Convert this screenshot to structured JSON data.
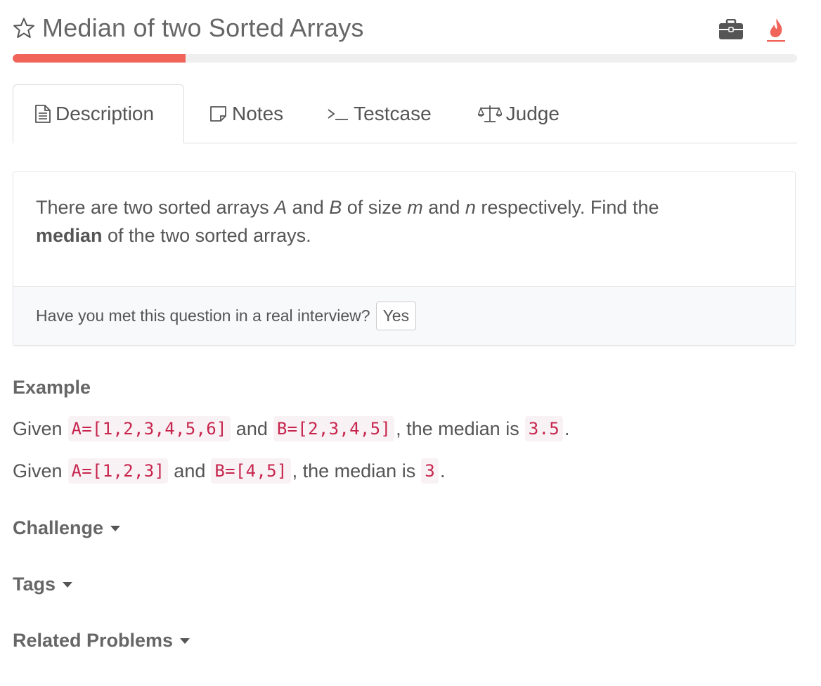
{
  "header": {
    "title": "Median of two Sorted Arrays",
    "progress_percent": 22
  },
  "tabs": [
    {
      "label": "Description",
      "icon": "document-icon",
      "active": true
    },
    {
      "label": "Notes",
      "icon": "note-icon",
      "active": false
    },
    {
      "label": "Testcase",
      "icon": "terminal-icon",
      "active": false
    },
    {
      "label": "Judge",
      "icon": "scale-icon",
      "active": false
    }
  ],
  "description": {
    "text_1": "There are two sorted arrays ",
    "var_a": "A",
    "text_2": " and ",
    "var_b": "B",
    "text_3": " of size ",
    "var_m": "m",
    "text_4": " and ",
    "var_n": "n",
    "text_5": " respectively. Find the ",
    "bold_word": "median",
    "text_6": " of the two sorted arrays.",
    "interview_question": "Have you met this question in a real interview?",
    "yes_label": "Yes"
  },
  "example": {
    "heading": "Example",
    "lines": [
      {
        "given": "Given",
        "a": "A=[1,2,3,4,5,6]",
        "and": "and",
        "b": "B=[2,3,4,5]",
        "mid": ", the median is",
        "result": "3.5",
        "end": "."
      },
      {
        "given": "Given",
        "a": "A=[1,2,3]",
        "and": "and",
        "b": "B=[4,5]",
        "mid": ", the median is",
        "result": "3",
        "end": "."
      }
    ]
  },
  "sections": {
    "challenge": "Challenge",
    "tags": "Tags",
    "related": "Related Problems"
  },
  "colors": {
    "accent": "#f0645a",
    "code_text": "#c7254e",
    "code_bg": "#f9f2f4"
  }
}
